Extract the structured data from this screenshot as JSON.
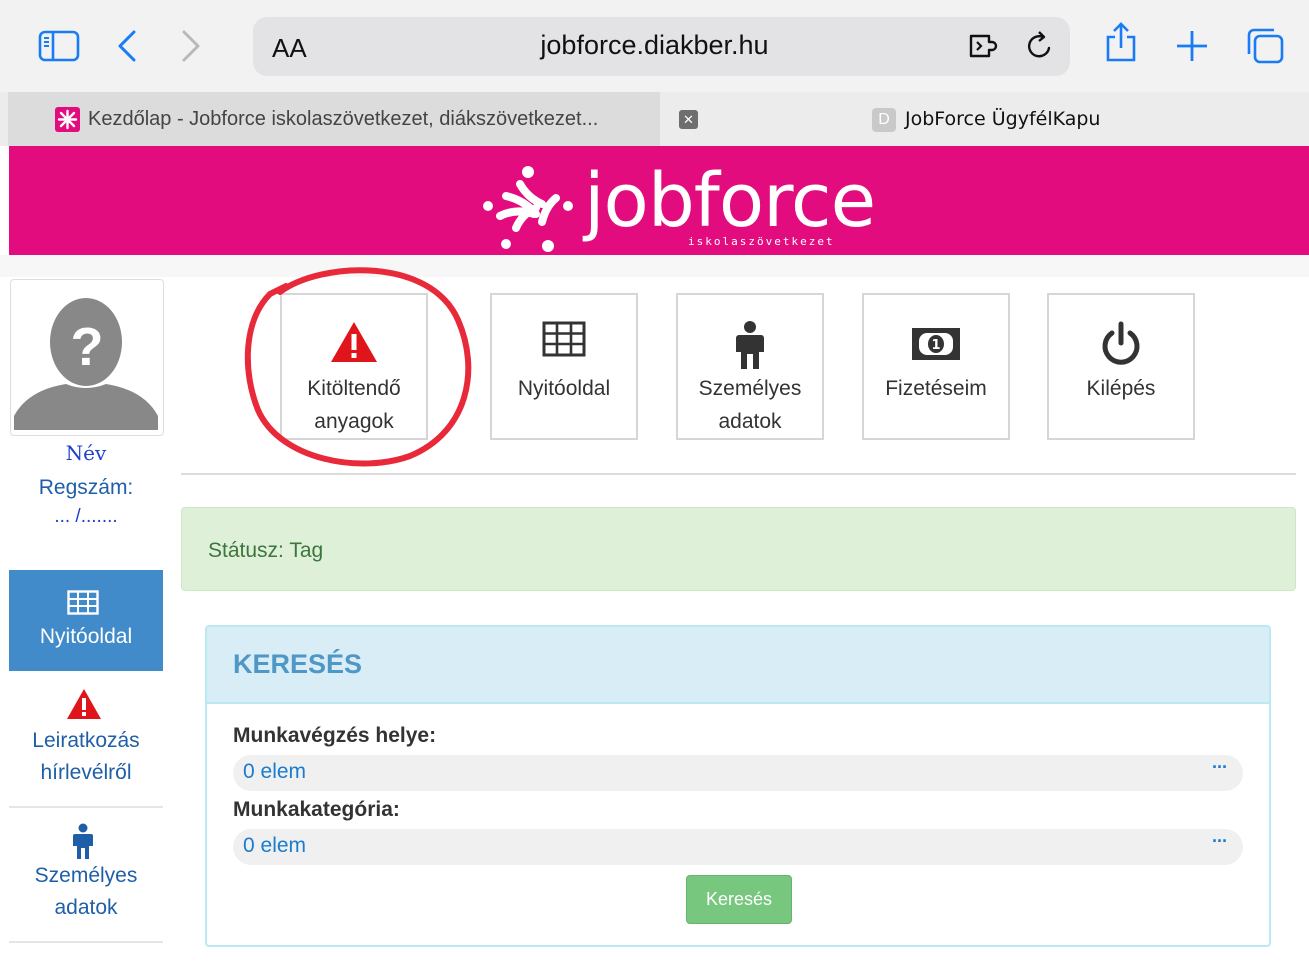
{
  "browser": {
    "text_size_label": "AA",
    "url": "jobforce.diakber.hu",
    "tabs": [
      {
        "title": "Kezdőlap - Jobforce iskolaszövetkezet, diákszövetkezet...",
        "favicon": "jobforce-favicon",
        "active": true
      },
      {
        "title": "JobForce ÜgyfélKapu",
        "favicon_letter": "D",
        "active": false
      }
    ],
    "close_tab_glyph": "✕"
  },
  "brand": {
    "name": "jobforce",
    "tagline": "iskolaszövetkezet",
    "color": "#e20c7e"
  },
  "sidebar": {
    "avatar_glyph": "?",
    "name_label": "Név",
    "reg_label": "Regszám:",
    "reg_value": "... /.......",
    "items": [
      {
        "label": "Nyitóoldal",
        "icon": "table-icon",
        "active": true
      },
      {
        "label1": "Leiratkozás",
        "label2": "hírlevélről",
        "icon": "warning-icon"
      },
      {
        "label1": "Személyes",
        "label2": "adatok",
        "icon": "person-icon"
      }
    ]
  },
  "tiles": [
    {
      "line1": "Kitöltendő",
      "line2": "anyagok",
      "icon": "warning-icon",
      "highlighted": true
    },
    {
      "line1": "Nyitóoldal",
      "line2": "",
      "icon": "table-icon"
    },
    {
      "line1": "Személyes",
      "line2": "adatok",
      "icon": "person-icon"
    },
    {
      "line1": "Fizetéseim",
      "line2": "",
      "icon": "money-icon"
    },
    {
      "line1": "Kilépés",
      "line2": "",
      "icon": "power-icon"
    }
  ],
  "status": {
    "text": "Státusz: Tag"
  },
  "search": {
    "title": "KERESÉS",
    "field1_label": "Munkavégzés helye:",
    "field1_value": "0 elem",
    "field2_label": "Munkakategória:",
    "field2_value": "0 elem",
    "more_glyph": "···",
    "button_label": "Keresés"
  },
  "colors": {
    "accent_blue": "#428bca",
    "danger": "#e0151c",
    "success_btn": "#77c77e",
    "annotation": "#e8293a"
  }
}
